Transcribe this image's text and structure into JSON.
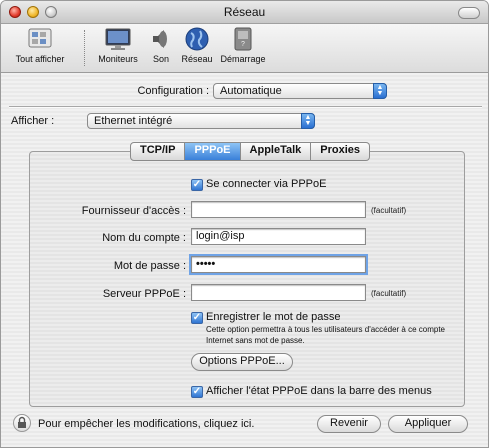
{
  "window": {
    "title": "Réseau"
  },
  "toolbar": {
    "items": [
      {
        "label": "Tout afficher",
        "icon": "show-all-icon"
      },
      {
        "label": "Moniteurs",
        "icon": "monitor-icon"
      },
      {
        "label": "Son",
        "icon": "speaker-icon"
      },
      {
        "label": "Réseau",
        "icon": "network-globe-icon"
      },
      {
        "label": "Démarrage",
        "icon": "startup-disk-icon"
      }
    ]
  },
  "configuration": {
    "label": "Configuration :",
    "value": "Automatique"
  },
  "show": {
    "label": "Afficher :",
    "value": "Ethernet intégré"
  },
  "tabs": [
    {
      "label": "TCP/IP",
      "selected": false
    },
    {
      "label": "PPPoE",
      "selected": true
    },
    {
      "label": "AppleTalk",
      "selected": false
    },
    {
      "label": "Proxies",
      "selected": false
    }
  ],
  "pppoe": {
    "connect_checkbox": {
      "label": "Se connecter via PPPoE",
      "checked": true
    },
    "provider": {
      "label": "Fournisseur d'accès :",
      "value": "",
      "optional": "(facultatif)"
    },
    "account": {
      "label": "Nom du compte :",
      "value": "login@isp"
    },
    "password": {
      "label": "Mot de passe :",
      "value": "•••••"
    },
    "server": {
      "label": "Serveur PPPoE :",
      "value": "",
      "optional": "(facultatif)"
    },
    "save_password": {
      "label": "Enregistrer le mot de passe",
      "checked": true,
      "help": "Cette option permettra à tous les utilisateurs d'accéder à ce compte Internet sans mot de passe."
    },
    "options_button": "Options PPPoE...",
    "show_status": {
      "label": "Afficher l'état PPPoE dans la barre des menus",
      "checked": true
    }
  },
  "footer": {
    "lock_text": "Pour empêcher les modifications, cliquez ici.",
    "revert": "Revenir",
    "apply": "Appliquer"
  },
  "colors": {
    "accent": "#3a80d9",
    "selected_tab": "#3a80d9"
  }
}
